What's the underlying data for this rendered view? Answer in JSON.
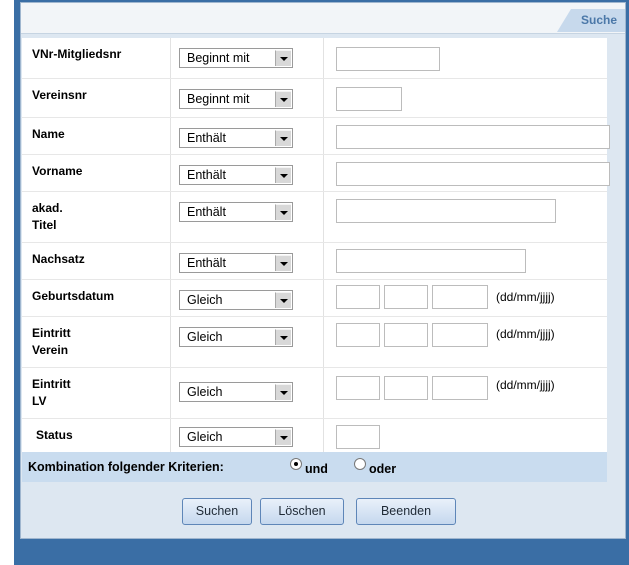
{
  "panel": {
    "tab_label": "Suche"
  },
  "rows": [
    {
      "label": "VNr-Mitgliedsnr",
      "operator": "Beginnt mit"
    },
    {
      "label": "Vereinsnr",
      "operator": "Beginnt mit"
    },
    {
      "label": "Name",
      "operator": "Enthält"
    },
    {
      "label": "Vorname",
      "operator": "Enthält"
    },
    {
      "label": "akad. Titel",
      "label_line1": "akad.",
      "label_line2": "Titel",
      "operator": "Enthält"
    },
    {
      "label": "Nachsatz",
      "operator": "Enthält"
    },
    {
      "label": "Geburtsdatum",
      "operator": "Gleich",
      "format_hint": "(dd/mm/jjjj)"
    },
    {
      "label": "Eintritt Verein",
      "label_line1": "Eintritt",
      "label_line2": "Verein",
      "operator": "Gleich",
      "format_hint": "(dd/mm/jjjj)"
    },
    {
      "label": "Eintritt LV",
      "label_line1": "Eintritt",
      "label_line2": "LV",
      "operator": "Gleich",
      "format_hint": "(dd/mm/jjjj)"
    },
    {
      "label": "Status",
      "operator": "Gleich"
    }
  ],
  "combination": {
    "label": "Kombination folgender Kriterien:",
    "option_and": "und",
    "option_or": "oder",
    "selected": "und"
  },
  "actions": {
    "search": "Suchen",
    "clear": "Löschen",
    "exit": "Beenden"
  },
  "colors": {
    "frame": "#3a6ea5",
    "panel": "#dde7f1",
    "tab": "#c7d9ec",
    "combo_bar": "#c9dcef"
  }
}
